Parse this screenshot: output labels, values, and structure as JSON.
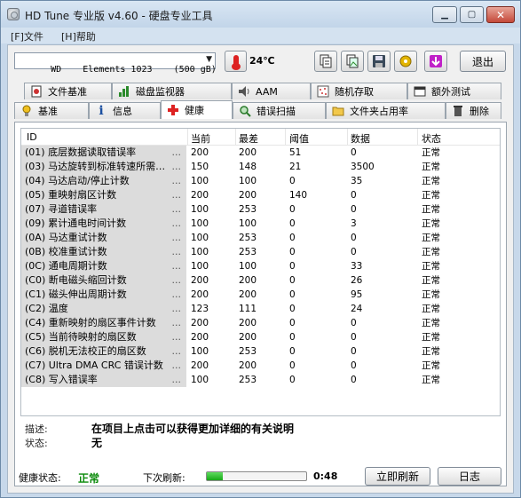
{
  "window": {
    "title": "HD Tune 专业版 v4.60 - 硬盘专业工具",
    "minimize_label": "▁",
    "maximize_label": "▢",
    "close_label": "✕"
  },
  "menu": [
    {
      "label": "[F]文件"
    },
    {
      "label": "[H]帮助"
    }
  ],
  "toolbar": {
    "drive": "WD    Elements 1023    (500 gB)",
    "temperature": "24℃",
    "exit_label": "退出"
  },
  "tabs_row1": [
    {
      "label": "文件基准",
      "icon": "file-benchmark-icon"
    },
    {
      "label": "磁盘监视器",
      "icon": "disk-monitor-icon"
    },
    {
      "label": "AAM",
      "icon": "speaker-icon"
    },
    {
      "label": "随机存取",
      "icon": "random-access-icon"
    },
    {
      "label": "额外测试",
      "icon": "extra-tests-icon"
    }
  ],
  "tabs_row2": [
    {
      "label": "基准",
      "icon": "benchmark-icon"
    },
    {
      "label": "信息",
      "icon": "info-icon"
    },
    {
      "label": "健康",
      "icon": "health-cross-icon"
    },
    {
      "label": "错误扫描",
      "icon": "magnifier-icon"
    },
    {
      "label": "文件夹占用率",
      "icon": "folder-icon"
    },
    {
      "label": "删除",
      "icon": "trash-icon"
    }
  ],
  "table": {
    "headers": [
      "ID",
      "当前",
      "最差",
      "阈值",
      "数据",
      "状态"
    ],
    "rows": [
      {
        "id": "(01) 底层数据读取错误率",
        "cur": "200",
        "worst": "200",
        "thr": "51",
        "data": "0",
        "status": "正常"
      },
      {
        "id": "(03) 马达旋转到标准转速所需…",
        "cur": "150",
        "worst": "148",
        "thr": "21",
        "data": "3500",
        "status": "正常"
      },
      {
        "id": "(04) 马达启动/停止计数",
        "cur": "100",
        "worst": "100",
        "thr": "0",
        "data": "35",
        "status": "正常"
      },
      {
        "id": "(05) 重映射扇区计数",
        "cur": "200",
        "worst": "200",
        "thr": "140",
        "data": "0",
        "status": "正常"
      },
      {
        "id": "(07) 寻道错误率",
        "cur": "100",
        "worst": "253",
        "thr": "0",
        "data": "0",
        "status": "正常"
      },
      {
        "id": "(09) 累计通电时间计数",
        "cur": "100",
        "worst": "100",
        "thr": "0",
        "data": "3",
        "status": "正常"
      },
      {
        "id": "(0A) 马达重试计数",
        "cur": "100",
        "worst": "253",
        "thr": "0",
        "data": "0",
        "status": "正常"
      },
      {
        "id": "(0B) 校准重试计数",
        "cur": "100",
        "worst": "253",
        "thr": "0",
        "data": "0",
        "status": "正常"
      },
      {
        "id": "(0C) 通电周期计数",
        "cur": "100",
        "worst": "100",
        "thr": "0",
        "data": "33",
        "status": "正常"
      },
      {
        "id": "(C0) 断电磁头缩回计数",
        "cur": "200",
        "worst": "200",
        "thr": "0",
        "data": "26",
        "status": "正常"
      },
      {
        "id": "(C1) 磁头伸出周期计数",
        "cur": "200",
        "worst": "200",
        "thr": "0",
        "data": "95",
        "status": "正常"
      },
      {
        "id": "(C2) 温度",
        "cur": "123",
        "worst": "111",
        "thr": "0",
        "data": "24",
        "status": "正常"
      },
      {
        "id": "(C4) 重新映射的扇区事件计数",
        "cur": "200",
        "worst": "200",
        "thr": "0",
        "data": "0",
        "status": "正常"
      },
      {
        "id": "(C5) 当前待映射的扇区数",
        "cur": "200",
        "worst": "200",
        "thr": "0",
        "data": "0",
        "status": "正常"
      },
      {
        "id": "(C6) 脱机无法校正的扇区数",
        "cur": "100",
        "worst": "253",
        "thr": "0",
        "data": "0",
        "status": "正常"
      },
      {
        "id": "(C7) Ultra DMA CRC 错误计数",
        "cur": "200",
        "worst": "200",
        "thr": "0",
        "data": "0",
        "status": "正常"
      },
      {
        "id": "(C8) 写入错误率",
        "cur": "100",
        "worst": "253",
        "thr": "0",
        "data": "0",
        "status": "正常"
      }
    ],
    "dots": "..."
  },
  "details": {
    "desc_label": "描述:",
    "desc_text": "在项目上点击可以获得更加详细的有关说明",
    "status_label": "状态:",
    "status_text": "无"
  },
  "footer": {
    "health_label": "健康状态:",
    "health_value": "正常",
    "health_color": "#0a8a0a",
    "next_refresh_label": "下次刷新:",
    "refresh_progress": 0.16,
    "countdown": "0:48",
    "refresh_now_label": "立即刷新",
    "log_label": "日志"
  }
}
